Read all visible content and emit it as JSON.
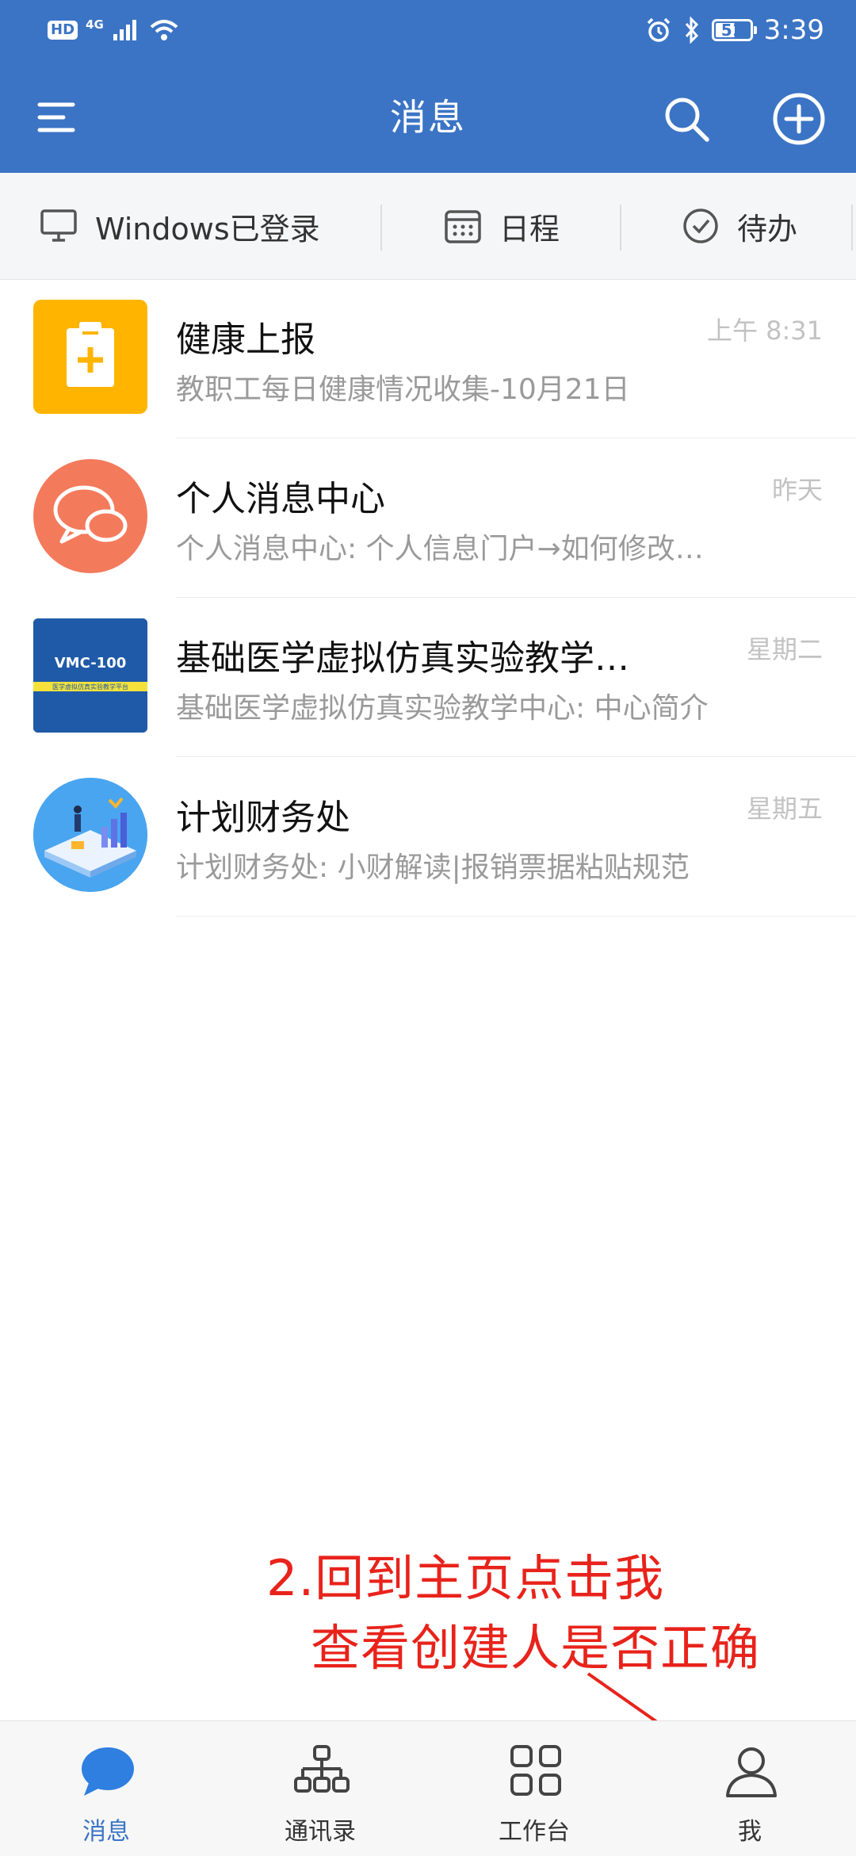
{
  "status_bar": {
    "hd": "HD",
    "network": "4G",
    "battery": "51",
    "time": "3:39"
  },
  "header": {
    "title": "消息",
    "icons": [
      "menu-icon",
      "search-icon",
      "add-circle-icon"
    ]
  },
  "quickbar": {
    "items": [
      {
        "label": "Windows已登录",
        "icon": "monitor-icon"
      },
      {
        "label": "日程",
        "icon": "calendar-icon"
      },
      {
        "label": "待办",
        "icon": "check-circle-icon"
      }
    ]
  },
  "messages": [
    {
      "title": "健康上报",
      "subtitle": "教职工每日健康情况收集-10月21日",
      "time": "上午 8:31"
    },
    {
      "title": "个人消息中心",
      "subtitle": "个人消息中心: 个人信息门户→如何修改…",
      "time": "昨天"
    },
    {
      "title": "基础医学虚拟仿真实验教学…",
      "subtitle": "基础医学虚拟仿真实验教学中心: 中心简介",
      "time": "星期二",
      "logo_text": "VMC-100",
      "logo_subtext": "医学虚拟仿真实验教学平台"
    },
    {
      "title": "计划财务处",
      "subtitle": "计划财务处: 小财解读|报销票据粘贴规范",
      "time": "星期五"
    }
  ],
  "annotation": {
    "line1": "2.回到主页点击我",
    "line2": "查看创建人是否正确"
  },
  "bottom_nav": {
    "items": [
      {
        "label": "消息",
        "active": true
      },
      {
        "label": "通讯录",
        "active": false
      },
      {
        "label": "工作台",
        "active": false
      },
      {
        "label": "我",
        "active": false
      }
    ]
  },
  "colors": {
    "primary": "#3b74c5",
    "annotation_red": "#e8231b",
    "health_yellow": "#ffb400",
    "message_orange": "#f47a5c"
  }
}
